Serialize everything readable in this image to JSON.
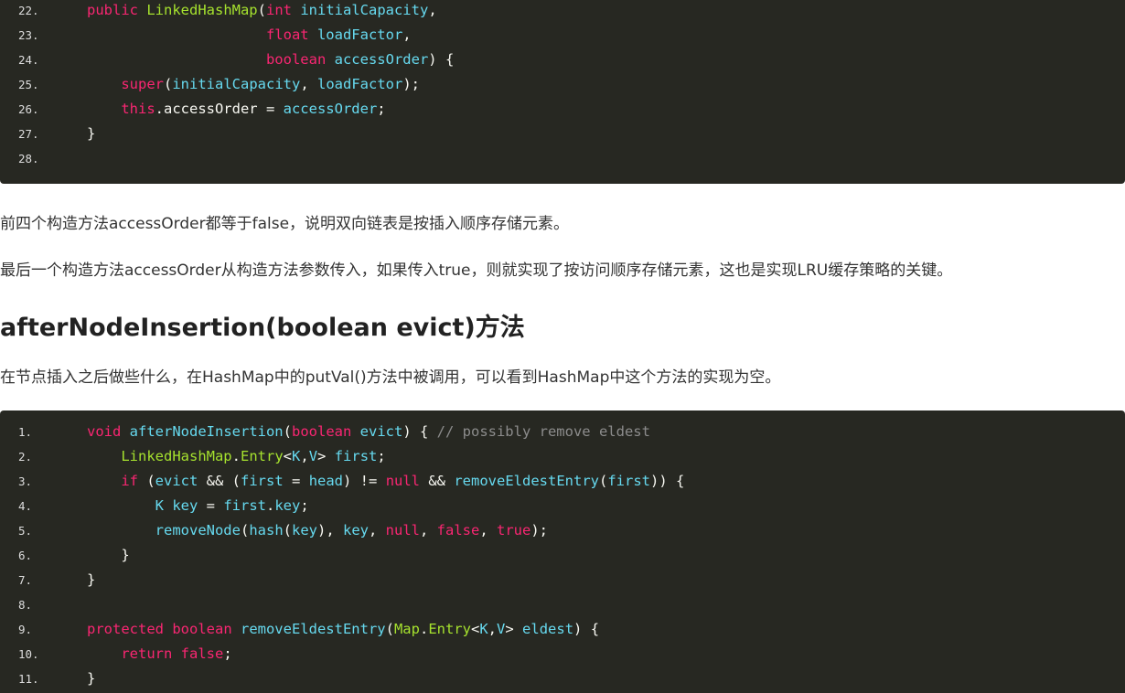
{
  "code_block_1": {
    "lines": [
      {
        "num": "22.",
        "tokens": [
          {
            "t": "public ",
            "c": "kw"
          },
          {
            "t": "LinkedHashMap",
            "c": "ty"
          },
          {
            "t": "("
          },
          {
            "t": "int ",
            "c": "kw"
          },
          {
            "t": "initialCapacity",
            "c": "id"
          },
          {
            "t": ","
          }
        ]
      },
      {
        "num": "23.",
        "tokens": [
          {
            "t": "                     "
          },
          {
            "t": "float ",
            "c": "kw"
          },
          {
            "t": "loadFactor",
            "c": "id"
          },
          {
            "t": ","
          }
        ]
      },
      {
        "num": "24.",
        "tokens": [
          {
            "t": "                     "
          },
          {
            "t": "boolean ",
            "c": "kw"
          },
          {
            "t": "accessOrder",
            "c": "id"
          },
          {
            "t": ") {"
          }
        ]
      },
      {
        "num": "25.",
        "tokens": [
          {
            "t": "    "
          },
          {
            "t": "super",
            "c": "kw"
          },
          {
            "t": "("
          },
          {
            "t": "initialCapacity",
            "c": "id"
          },
          {
            "t": ", "
          },
          {
            "t": "loadFactor",
            "c": "id"
          },
          {
            "t": ");"
          }
        ]
      },
      {
        "num": "26.",
        "tokens": [
          {
            "t": "    "
          },
          {
            "t": "this",
            "c": "kw"
          },
          {
            "t": ".accessOrder = "
          },
          {
            "t": "accessOrder",
            "c": "id"
          },
          {
            "t": ";"
          }
        ]
      },
      {
        "num": "27.",
        "tokens": [
          {
            "t": "}"
          }
        ]
      },
      {
        "num": "28.",
        "tokens": []
      }
    ]
  },
  "paragraphs": {
    "p1": "前四个构造方法accessOrder都等于false，说明双向链表是按插入顺序存储元素。",
    "p2": "最后一个构造方法accessOrder从构造方法参数传入，如果传入true，则就实现了按访问顺序存储元素，这也是实现LRU缓存策略的关键。",
    "p3": "在节点插入之后做些什么，在HashMap中的putVal()方法中被调用，可以看到HashMap中这个方法的实现为空。"
  },
  "heading": "afterNodeInsertion(boolean evict)方法",
  "code_block_2": {
    "lines": [
      {
        "num": "1.",
        "tokens": [
          {
            "t": "void ",
            "c": "kw"
          },
          {
            "t": "afterNodeInsertion",
            "c": "id"
          },
          {
            "t": "("
          },
          {
            "t": "boolean ",
            "c": "kw"
          },
          {
            "t": "evict",
            "c": "id"
          },
          {
            "t": ") { "
          },
          {
            "t": "// possibly remove eldest",
            "c": "cm"
          }
        ]
      },
      {
        "num": "2.",
        "tokens": [
          {
            "t": "    "
          },
          {
            "t": "LinkedHashMap",
            "c": "ty"
          },
          {
            "t": "."
          },
          {
            "t": "Entry",
            "c": "ty"
          },
          {
            "t": "<"
          },
          {
            "t": "K",
            "c": "id"
          },
          {
            "t": ","
          },
          {
            "t": "V",
            "c": "id"
          },
          {
            "t": "> "
          },
          {
            "t": "first",
            "c": "id"
          },
          {
            "t": ";"
          }
        ]
      },
      {
        "num": "3.",
        "tokens": [
          {
            "t": "    "
          },
          {
            "t": "if ",
            "c": "kw"
          },
          {
            "t": "("
          },
          {
            "t": "evict",
            "c": "id"
          },
          {
            "t": " && ("
          },
          {
            "t": "first",
            "c": "id"
          },
          {
            "t": " = "
          },
          {
            "t": "head",
            "c": "id"
          },
          {
            "t": ") != "
          },
          {
            "t": "null",
            "c": "kw"
          },
          {
            "t": " && "
          },
          {
            "t": "removeEldestEntry",
            "c": "id"
          },
          {
            "t": "("
          },
          {
            "t": "first",
            "c": "id"
          },
          {
            "t": ")) {"
          }
        ]
      },
      {
        "num": "4.",
        "tokens": [
          {
            "t": "        "
          },
          {
            "t": "K ",
            "c": "id"
          },
          {
            "t": "key",
            "c": "id"
          },
          {
            "t": " = "
          },
          {
            "t": "first",
            "c": "id"
          },
          {
            "t": "."
          },
          {
            "t": "key",
            "c": "id"
          },
          {
            "t": ";"
          }
        ]
      },
      {
        "num": "5.",
        "tokens": [
          {
            "t": "        "
          },
          {
            "t": "removeNode",
            "c": "id"
          },
          {
            "t": "("
          },
          {
            "t": "hash",
            "c": "id"
          },
          {
            "t": "("
          },
          {
            "t": "key",
            "c": "id"
          },
          {
            "t": "), "
          },
          {
            "t": "key",
            "c": "id"
          },
          {
            "t": ", "
          },
          {
            "t": "null",
            "c": "kw"
          },
          {
            "t": ", "
          },
          {
            "t": "false",
            "c": "kw"
          },
          {
            "t": ", "
          },
          {
            "t": "true",
            "c": "kw"
          },
          {
            "t": ");"
          }
        ]
      },
      {
        "num": "6.",
        "tokens": [
          {
            "t": "    }"
          }
        ]
      },
      {
        "num": "7.",
        "tokens": [
          {
            "t": "}"
          }
        ]
      },
      {
        "num": "8.",
        "tokens": []
      },
      {
        "num": "9.",
        "tokens": [
          {
            "t": "protected ",
            "c": "kw"
          },
          {
            "t": "boolean ",
            "c": "kw"
          },
          {
            "t": "removeEldestEntry",
            "c": "id"
          },
          {
            "t": "("
          },
          {
            "t": "Map",
            "c": "ty"
          },
          {
            "t": "."
          },
          {
            "t": "Entry",
            "c": "ty"
          },
          {
            "t": "<"
          },
          {
            "t": "K",
            "c": "id"
          },
          {
            "t": ","
          },
          {
            "t": "V",
            "c": "id"
          },
          {
            "t": "> "
          },
          {
            "t": "eldest",
            "c": "id"
          },
          {
            "t": ") {"
          }
        ]
      },
      {
        "num": "10.",
        "tokens": [
          {
            "t": "    "
          },
          {
            "t": "return ",
            "c": "kw"
          },
          {
            "t": "false",
            "c": "kw"
          },
          {
            "t": ";"
          }
        ]
      },
      {
        "num": "11.",
        "tokens": [
          {
            "t": "}"
          }
        ]
      }
    ]
  },
  "colors": {
    "code_background": "#272822",
    "keyword": "#f92672",
    "type": "#a6e22e",
    "identifier": "#66d9ef",
    "comment": "#8c8c8c",
    "plain": "#f8f8f2"
  }
}
